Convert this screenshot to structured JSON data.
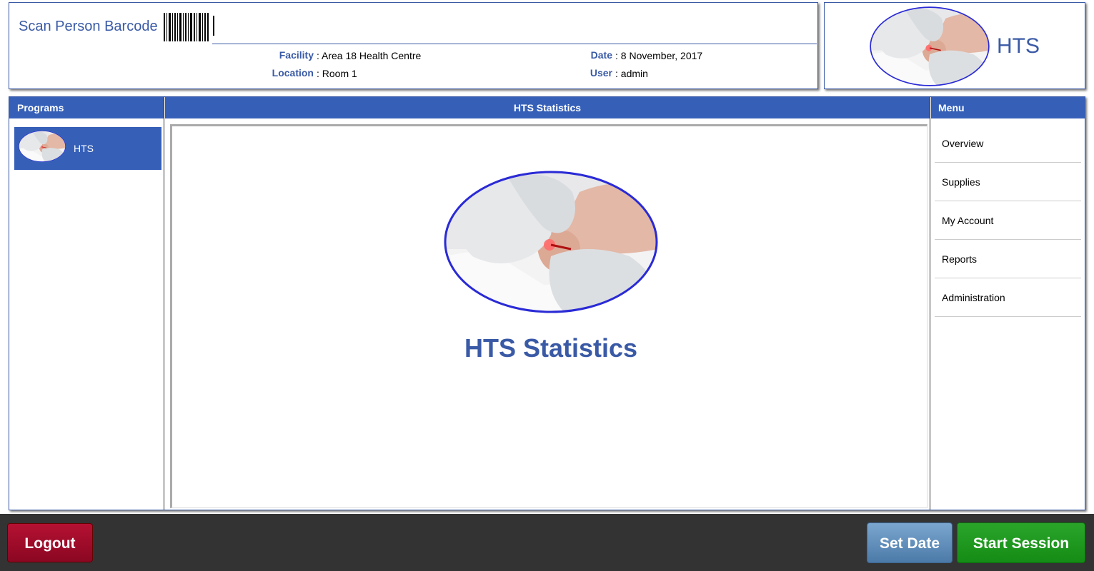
{
  "header": {
    "scan_label": "Scan Person Barcode",
    "scan_value": "",
    "facility_label": "Facility",
    "facility_value": ": Area 18 Health Centre",
    "location_label": "Location",
    "location_value": ": Room 1",
    "date_label": "Date",
    "date_value": ": 8 November, 2017",
    "user_label": "User",
    "user_value": ": admin",
    "program_title": "HTS"
  },
  "programs": {
    "title": "Programs",
    "items": [
      {
        "label": "HTS",
        "selected": true
      }
    ]
  },
  "content": {
    "title": "HTS Statistics",
    "hero_title": "HTS Statistics"
  },
  "menu": {
    "title": "Menu",
    "items": [
      {
        "label": "Overview"
      },
      {
        "label": "Supplies"
      },
      {
        "label": "My Account"
      },
      {
        "label": "Reports"
      },
      {
        "label": "Administration"
      }
    ]
  },
  "footer": {
    "logout_label": "Logout",
    "set_date_label": "Set Date",
    "start_session_label": "Start Session"
  },
  "colors": {
    "accent_blue": "#3660b8",
    "text_blue": "#3a5aa6",
    "logout_red": "#a00c2a",
    "set_date_blue": "#6692bf",
    "start_green": "#1f9a1f",
    "footer_bg": "#333333"
  }
}
